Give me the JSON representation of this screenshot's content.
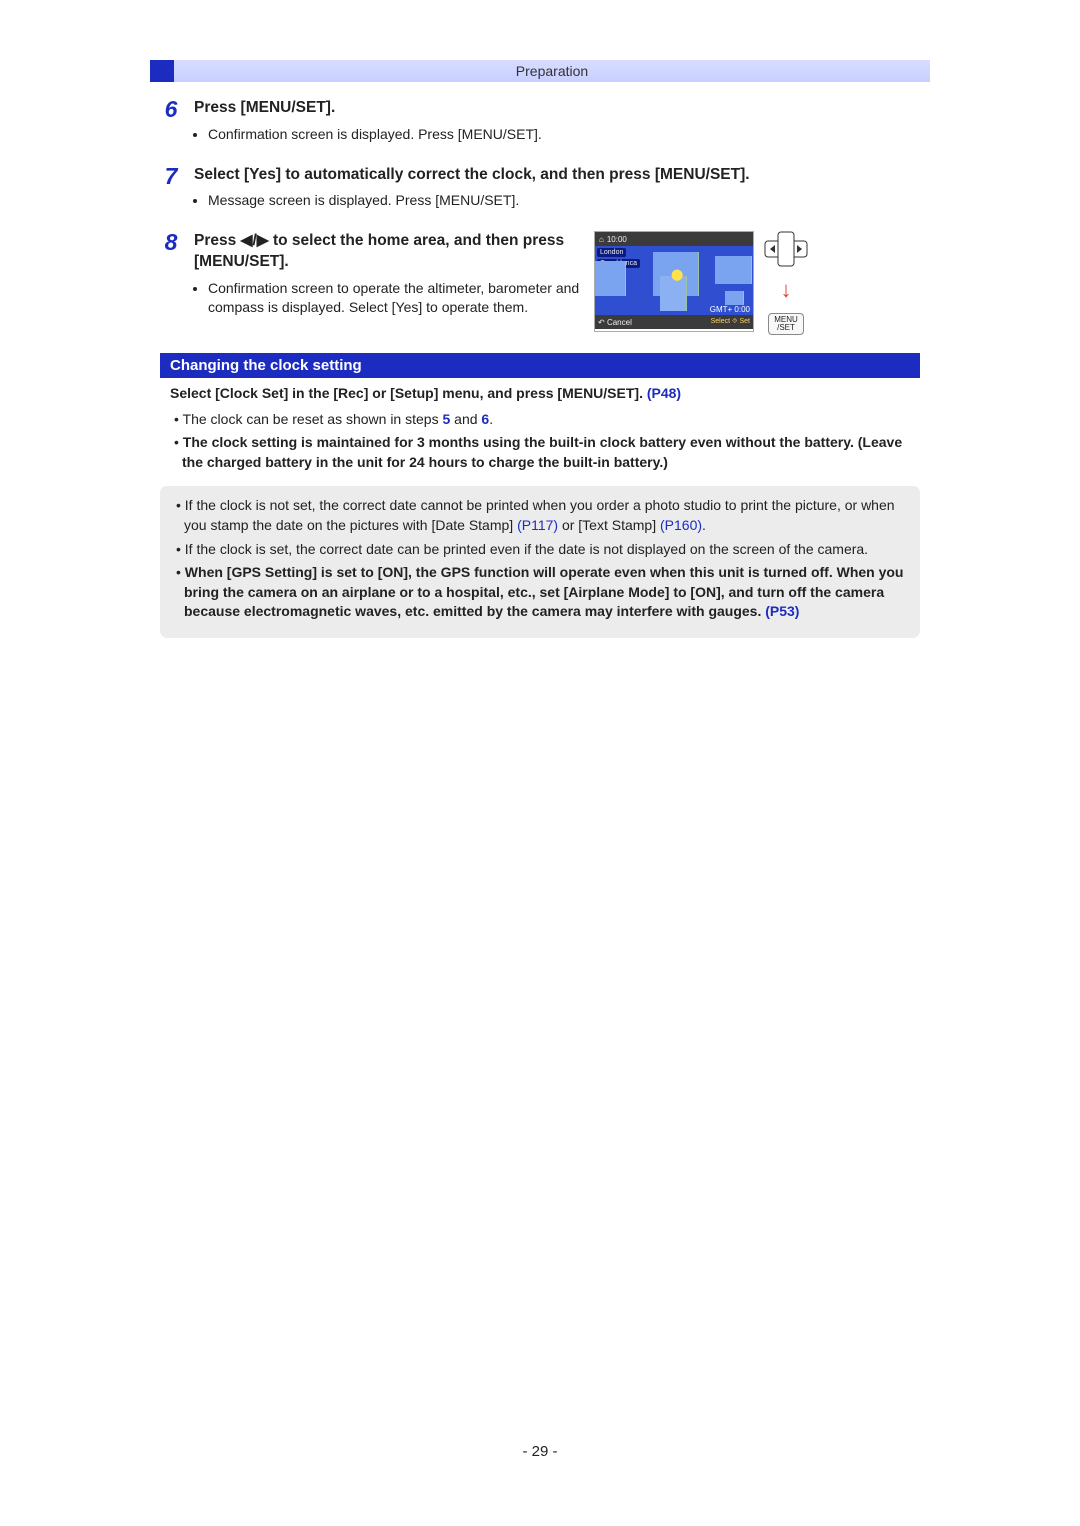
{
  "header": {
    "section": "Preparation"
  },
  "steps": [
    {
      "num": "6",
      "title": "Press [MENU/SET].",
      "bullets": [
        "Confirmation screen is displayed. Press [MENU/SET]."
      ]
    },
    {
      "num": "7",
      "title": "Select [Yes] to automatically correct the clock, and then press [MENU/SET].",
      "bullets": [
        "Message screen is displayed. Press [MENU/SET]."
      ]
    },
    {
      "num": "8",
      "title": "Press ◀/▶ to select the home area, and then press [MENU/SET].",
      "bullets": [
        "Confirmation screen to operate the altimeter, barometer and compass is displayed. Select [Yes] to operate them."
      ]
    }
  ],
  "map": {
    "time": "10:00",
    "city1": "London",
    "city2": "Casablanca",
    "gmt": "GMT+ 0:00",
    "cancel": "Cancel",
    "select": "Select ⯑ Set"
  },
  "controls": {
    "menu_set": "MENU\n/SET"
  },
  "clock_section": {
    "heading": "Changing the clock setting",
    "select_line_pre": "Select [Clock Set] in the [Rec] or [Setup] menu, and press [MENU/SET]. ",
    "select_line_ref": "(P48)",
    "bullet1_pre": "The clock can be reset as shown in steps ",
    "bullet1_step5": "5",
    "bullet1_mid": " and ",
    "bullet1_step6": "6",
    "bullet1_post": ".",
    "bullet2": "The clock setting is maintained for 3 months using the built-in clock battery even without the battery. (Leave the charged battery in the unit for 24 hours to charge the built-in battery.)"
  },
  "info_box": {
    "item1_pre": "If the clock is not set, the correct date cannot be printed when you order a photo studio to print the picture, or when you stamp the date on the pictures with [Date Stamp] ",
    "item1_ref1": "(P117)",
    "item1_mid": " or [Text Stamp] ",
    "item1_ref2": "(P160)",
    "item1_post": ".",
    "item2": "If the clock is set, the correct date can be printed even if the date is not displayed on the screen of the camera.",
    "item3_pre": "When [GPS Setting] is set to [ON], the GPS function will operate even when this unit is turned off. When you bring the camera on an airplane or to a hospital, etc., set [Airplane Mode] to [ON], and turn off the camera because electromagnetic waves, etc. emitted by the camera may interfere with gauges. ",
    "item3_ref": "(P53)"
  },
  "page_number": "- 29 -"
}
